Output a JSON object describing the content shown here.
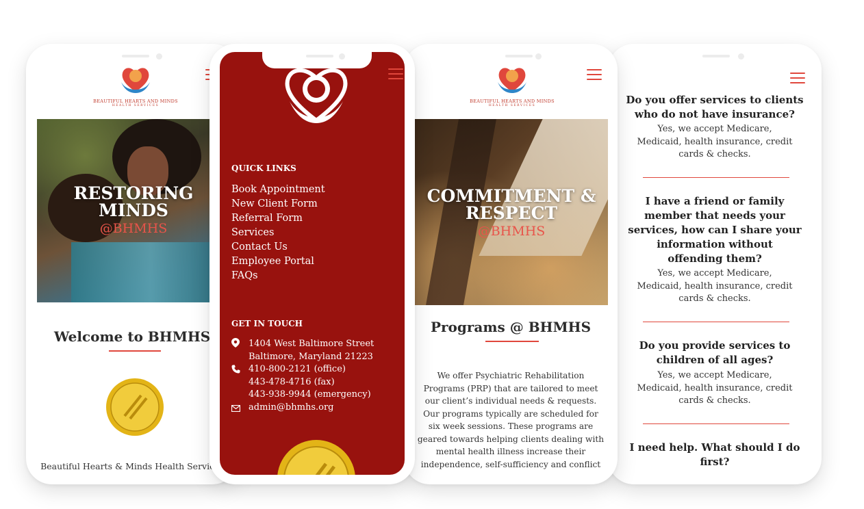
{
  "brand": {
    "name": "BEAUTIFUL HEARTS AND MINDS",
    "subtitle": "HEALTH SERVICES"
  },
  "colors": {
    "accent": "#e0473c",
    "menu_bg": "#98120e",
    "heart": "#e0473c",
    "hands": "#2e86c8"
  },
  "icons": [
    "menu-icon",
    "logo-icon",
    "location-pin-icon",
    "phone-icon",
    "mail-icon",
    "joint-commission-seal"
  ],
  "phone1": {
    "hero_title": "RESTORING MINDS",
    "hero_line1": "RESTORING",
    "hero_line2": "MINDS",
    "hero_sub": "@BHMHS",
    "welcome_title": "Welcome to BHMHS",
    "footer_text": "Beautiful Hearts & Minds Health Services"
  },
  "phone2": {
    "quick_links_title": "QUICK LINKS",
    "quick_links": [
      "Book Appointment",
      "New Client Form",
      "Referral Form",
      "Services",
      "Contact Us",
      "Employee Portal",
      "FAQs"
    ],
    "get_in_touch_title": "GET IN TOUCH",
    "address_line1": "1404 West Baltimore Street",
    "address_line2": "Baltimore, Maryland 21223",
    "phone_office": "410-800-2121 (office)",
    "phone_fax": "443-478-4716 (fax)",
    "phone_emergency": "443-938-9944 (emergency)",
    "email": "admin@bhmhs.org"
  },
  "phone3": {
    "hero_line1": "COMMITMENT &",
    "hero_line2": "RESPECT",
    "hero_sub": "@BHMHS",
    "programs_title": "Programs @ BHMHS",
    "programs_lines": [
      "We offer Psychiatric Rehabilitation",
      "Programs (PRP) that are tailored to meet",
      "our client’s individual needs & requests.",
      "Our programs typically are scheduled for",
      "six week sessions. These programs are",
      "geared towards helping clients dealing with",
      "mental health illness increase their",
      "independence, self-sufficiency and conflict"
    ]
  },
  "phone4": {
    "faqs": [
      {
        "question_lines": [
          "Do you offer services to clients",
          "who do not have insurance?"
        ],
        "answer_lines": [
          "Yes, we accept Medicare,",
          "Medicaid, health insurance, credit",
          "cards & checks."
        ]
      },
      {
        "question_lines": [
          "I have a friend or family",
          "member that needs your",
          "services, how can I share your",
          "information without",
          "offending them?"
        ],
        "answer_lines": [
          "Yes, we accept Medicare,",
          "Medicaid, health insurance, credit",
          "cards & checks."
        ]
      },
      {
        "question_lines": [
          "Do you provide services to",
          "children of all ages?"
        ],
        "answer_lines": [
          "Yes, we accept Medicare,",
          "Medicaid, health insurance, credit",
          "cards & checks."
        ]
      },
      {
        "question_lines": [
          "I need help. What should I do",
          "first?"
        ],
        "answer_lines": []
      }
    ]
  }
}
